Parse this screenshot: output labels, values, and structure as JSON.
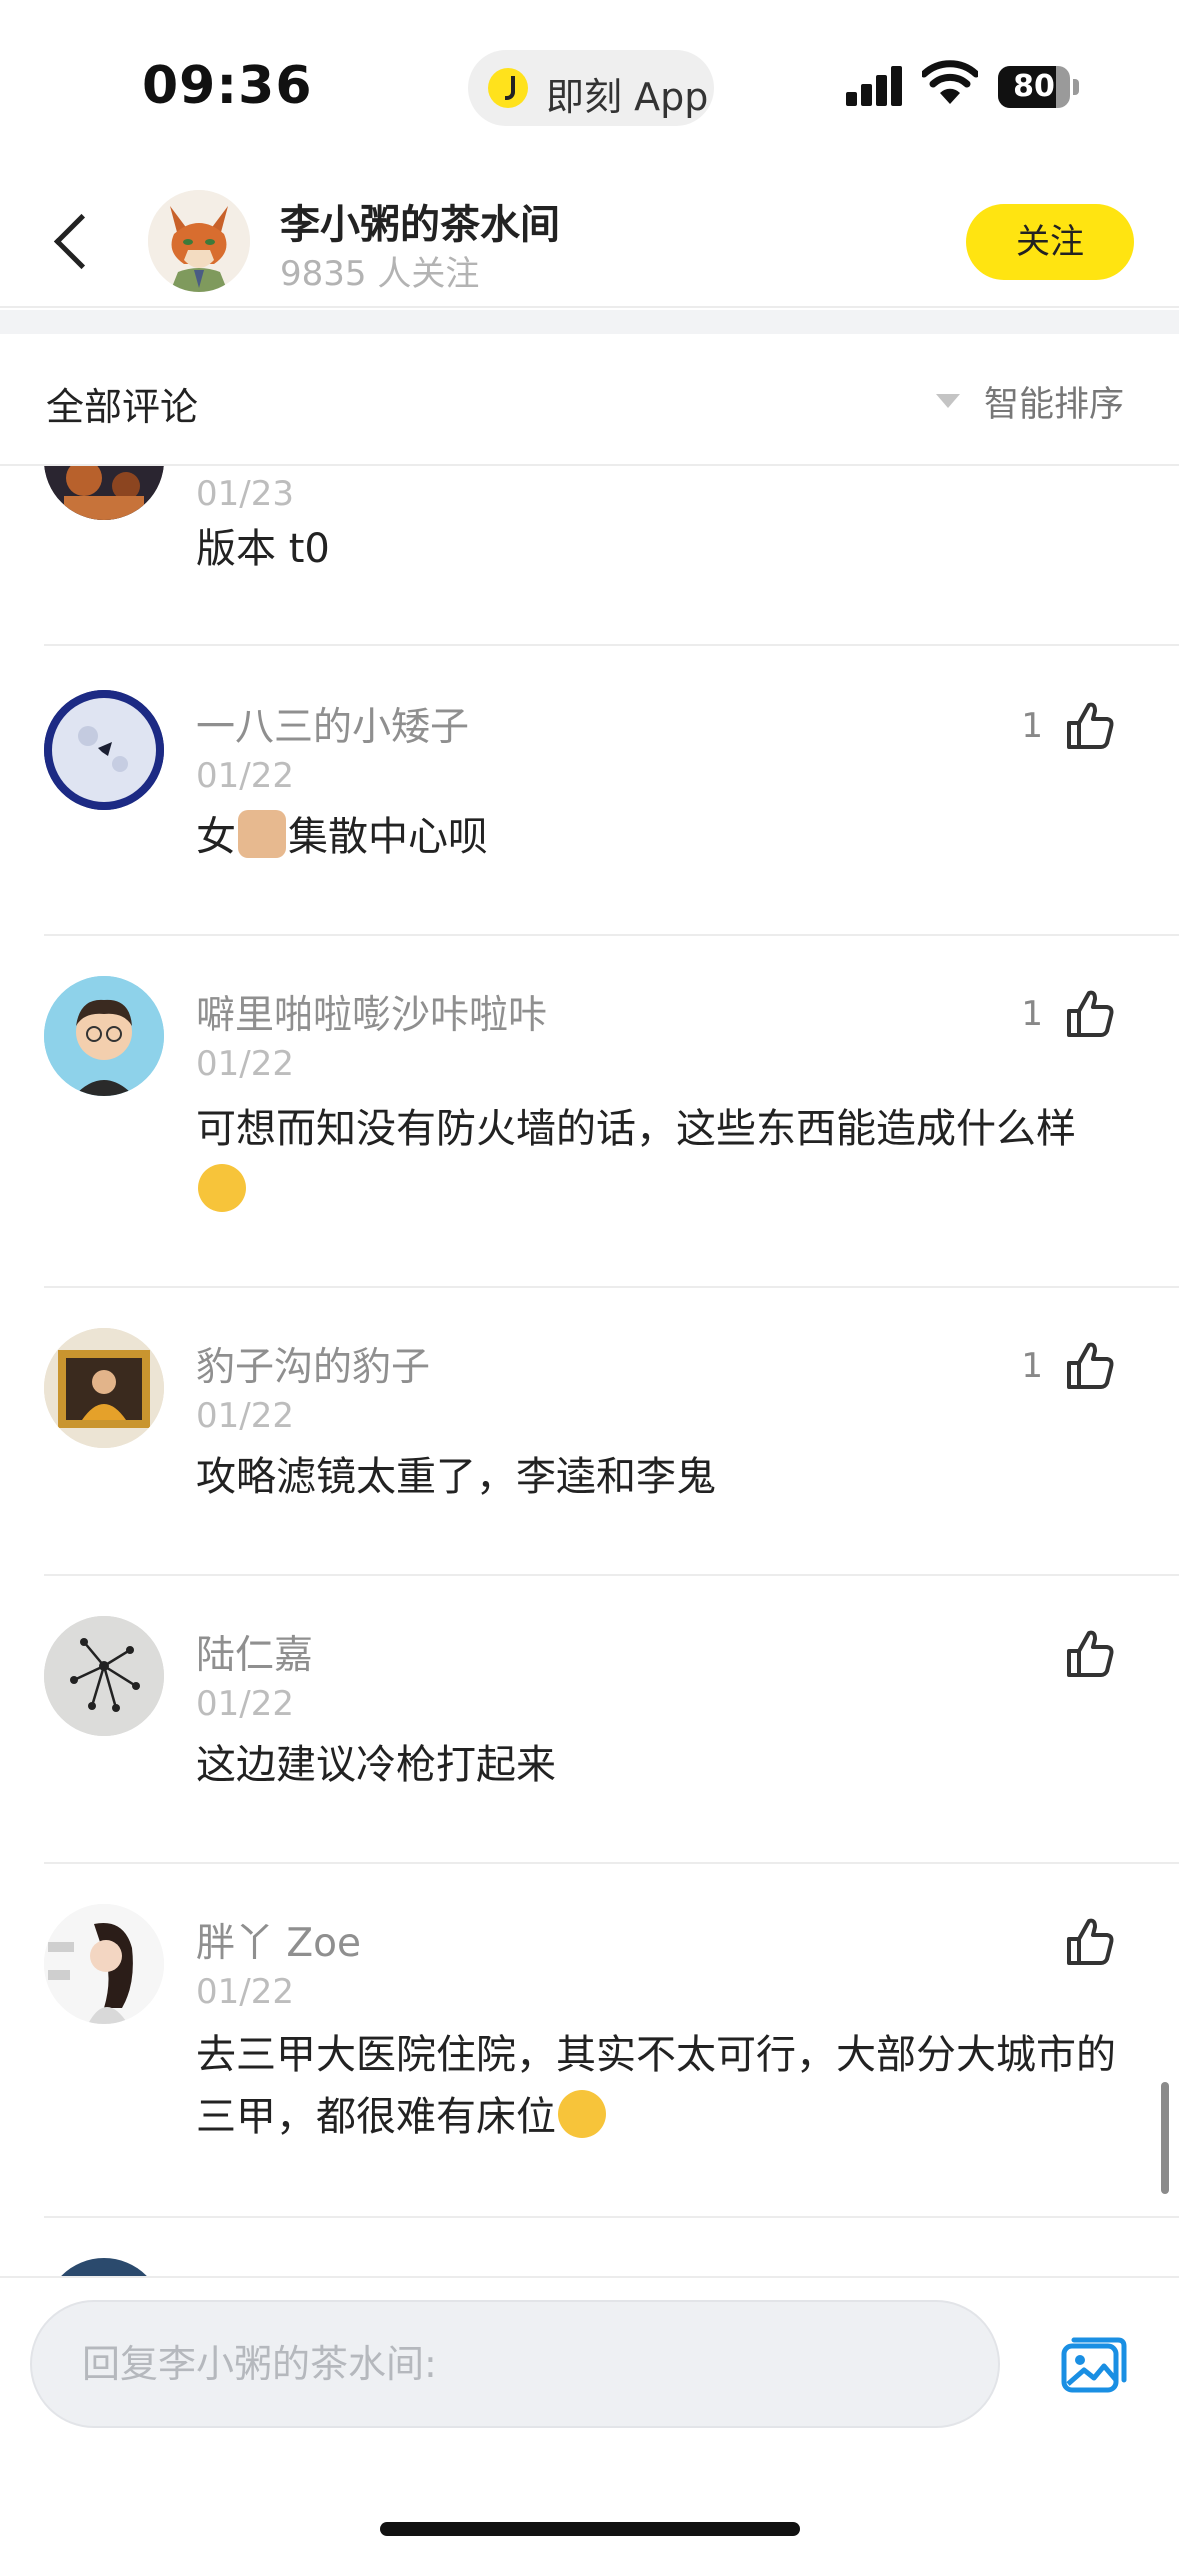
{
  "status_bar": {
    "time": "09:36",
    "app_pill_label": "即刻 App",
    "battery_level": "80",
    "battery_fraction": 0.8
  },
  "header": {
    "channel_name": "李小粥的茶水间",
    "followers": "9835 人关注",
    "follow_label": "关注"
  },
  "sort_bar": {
    "title": "全部评论",
    "sort_label": "智能排序"
  },
  "comments": [
    {
      "author": "",
      "date": "01/23",
      "content": "版本 t0",
      "likes": ""
    },
    {
      "author": "一八三的小矮子",
      "date": "01/22",
      "content_parts": [
        "女",
        "集散中心呗"
      ],
      "emoji": "fist-emoji",
      "likes": "1"
    },
    {
      "author": "噼里啪啦嘭沙咔啦咔",
      "date": "01/22",
      "content": "可想而知没有防火墙的话，这些东西能造成什么样",
      "emoji": "thinking-emoji",
      "likes": "1"
    },
    {
      "author": "豹子沟的豹子",
      "date": "01/22",
      "content": "攻略滤镜太重了，李逵和李鬼",
      "likes": "1"
    },
    {
      "author": "陆仁嘉",
      "date": "01/22",
      "content": "这边建议冷枪打起来",
      "likes": ""
    },
    {
      "author": "胖丫 Zoe",
      "date": "01/22",
      "content": "去三甲大医院住院，其实不太可行，大部分大城市的三甲，都很难有床位",
      "emoji": "laughing-emoji",
      "likes": ""
    }
  ],
  "reply_bar": {
    "placeholder": "回复李小粥的茶水间:"
  },
  "colors": {
    "accent_yellow": "#ffe411",
    "text_primary": "#222222",
    "text_secondary": "#8f8f8f",
    "divider": "#ececec",
    "link_blue": "#1a8fe3"
  }
}
